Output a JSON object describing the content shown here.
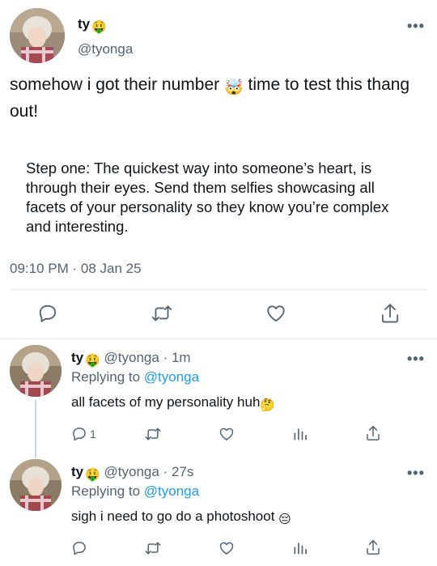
{
  "main_tweet": {
    "name": "ty",
    "name_emoji": "🤑",
    "handle": "@tyonga",
    "more": "•••",
    "text_part1": "somehow i got their number",
    "text_emoji": "🤯",
    "text_part2": "time to test this thang out!",
    "step": "Step one: The quickest way into someone’s heart, is through their eyes. Send them selfies showcasing all facets of your personality so they know you’re complex and interesting.",
    "timestamp": "09:10 PM · 08 Jan 25"
  },
  "actions": {
    "reply_icon": "reply-icon",
    "retweet_icon": "retweet-icon",
    "like_icon": "heart-icon",
    "share_icon": "share-icon"
  },
  "replies": [
    {
      "name": "ty",
      "name_emoji": "🤑",
      "handle": "@tyonga",
      "time": "· 1m",
      "replying_label": "Replying to",
      "replying_to": "@tyonga",
      "text": "all facets of my personality huh",
      "text_emoji": "🤔",
      "reply_count": "1",
      "more": "•••"
    },
    {
      "name": "ty",
      "name_emoji": "🤑",
      "handle": "@tyonga",
      "time": "· 27s",
      "replying_label": "Replying to",
      "replying_to": "@tyonga",
      "text": "sigh i need to go do a photoshoot",
      "text_emoji": "😔",
      "reply_count": "",
      "more": "•••"
    }
  ],
  "colors": {
    "link": "#1d9bf0",
    "secondary": "#536471",
    "divider": "#e6ecf0"
  }
}
